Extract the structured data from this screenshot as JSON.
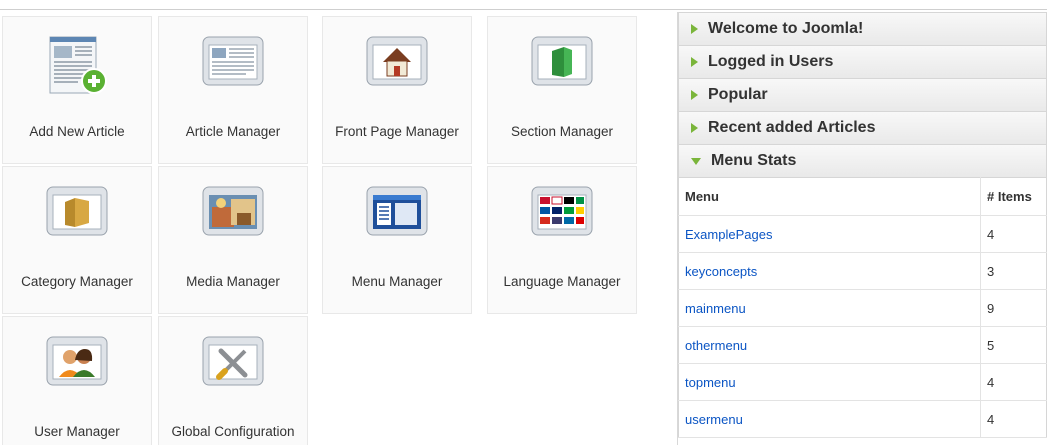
{
  "cpanel": {
    "tiles": [
      {
        "label": "Add New Article",
        "icon": "add-article-icon"
      },
      {
        "label": "Article Manager",
        "icon": "article-manager-icon"
      },
      {
        "label": "Front Page Manager",
        "icon": "home-icon"
      },
      {
        "label": "Section Manager",
        "icon": "section-icon"
      },
      {
        "label": "Category Manager",
        "icon": "category-icon"
      },
      {
        "label": "Media Manager",
        "icon": "media-icon"
      },
      {
        "label": "Menu Manager",
        "icon": "menu-icon"
      },
      {
        "label": "Language Manager",
        "icon": "language-flags-icon"
      },
      {
        "label": "User Manager",
        "icon": "users-icon"
      },
      {
        "label": "Global Configuration",
        "icon": "tools-icon"
      }
    ]
  },
  "sidepanel": {
    "panels": [
      {
        "title": "Welcome to Joomla!",
        "expanded": false
      },
      {
        "title": "Logged in Users",
        "expanded": false
      },
      {
        "title": "Popular",
        "expanded": false
      },
      {
        "title": "Recent added Articles",
        "expanded": false
      },
      {
        "title": "Menu Stats",
        "expanded": true
      }
    ],
    "menu_stats": {
      "headers": {
        "menu": "Menu",
        "items": "# Items"
      },
      "rows": [
        {
          "menu": "ExamplePages",
          "items": "4"
        },
        {
          "menu": "keyconcepts",
          "items": "3"
        },
        {
          "menu": "mainmenu",
          "items": "9"
        },
        {
          "menu": "othermenu",
          "items": "5"
        },
        {
          "menu": "topmenu",
          "items": "4"
        },
        {
          "menu": "usermenu",
          "items": "4"
        }
      ]
    }
  },
  "colors": {
    "accent": "#7ab53a",
    "link": "#0b55c4"
  }
}
